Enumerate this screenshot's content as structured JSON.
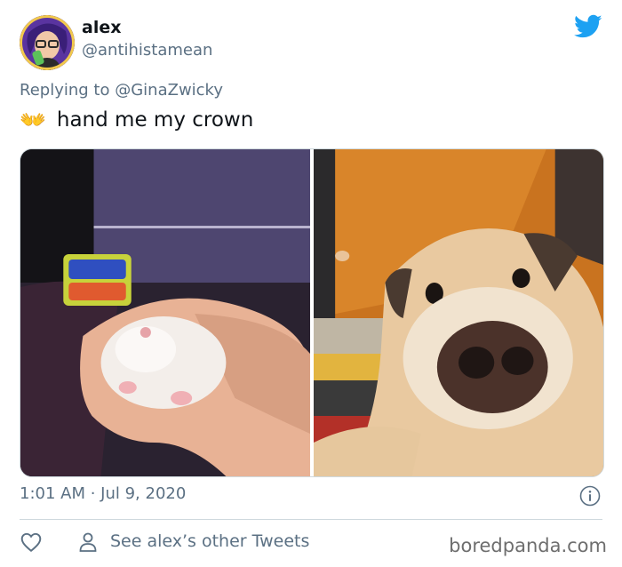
{
  "tweet": {
    "author": {
      "name": "alex",
      "handle": "@antihistamean"
    },
    "reply": {
      "prefix": "Replying to",
      "mention": "@GinaZwicky"
    },
    "emoji": "👐",
    "text": "hand me my crown",
    "timestamp": "1:01 AM · Jul 9, 2020",
    "other_tweets_label": "See alex’s other Tweets",
    "icons": {
      "logo": "twitter-bird-icon",
      "info": "info-icon",
      "like": "heart-icon",
      "profile": "person-icon"
    },
    "colors": {
      "brand": "#1da1f2",
      "secondary_text": "#5b7083",
      "primary_text": "#0f1419"
    }
  },
  "watermark": "boredpanda.com"
}
